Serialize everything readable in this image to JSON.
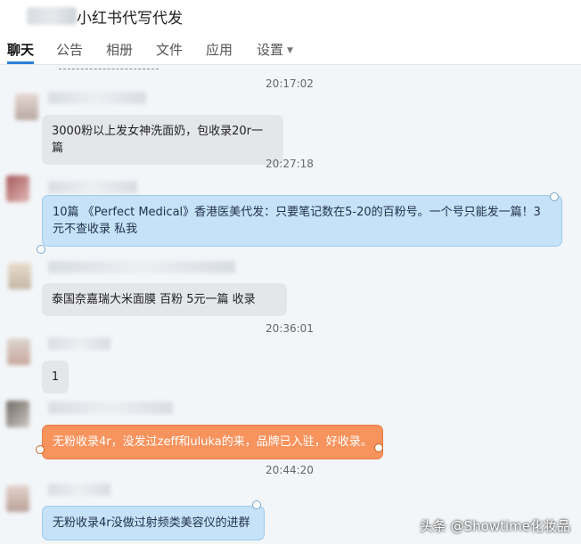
{
  "header": {
    "title": "小红书代写代发"
  },
  "tabs": [
    {
      "label": "聊天",
      "active": true
    },
    {
      "label": "公告"
    },
    {
      "label": "相册"
    },
    {
      "label": "文件"
    },
    {
      "label": "应用"
    },
    {
      "label": "设置"
    }
  ],
  "timestamps": [
    "20:17:02",
    "20:27:18",
    "20:36:01",
    "20:44:20"
  ],
  "messages": [
    {
      "text": "3000粉以上发女神洗面奶，包收录20r一篇",
      "style": "gray"
    },
    {
      "text": "10篇 《Perfect  Medical》香港医美代发：只要笔记数在5-20的百粉号。一个号只能发一篇！3元不查收录  私我",
      "style": "blue"
    },
    {
      "text": "泰国奈嘉瑞大米面膜   百粉  5元一篇    收录",
      "style": "gray"
    },
    {
      "text": "1",
      "style": "gray"
    },
    {
      "text": "无粉收录4r，没发过zeff和uluka的来，品牌已入驻，好收录。",
      "style": "orange"
    },
    {
      "text": "无粉收录4r没做过射频类美容仪的进群",
      "style": "blue"
    }
  ],
  "watermark": "头条 @Showtime化妆品",
  "colors": {
    "tab_accent": "#2d7fd6",
    "blue_bubble": "#c5e2f8",
    "orange_bubble": "#f7935d",
    "gray_bubble": "#e4e6ea"
  }
}
